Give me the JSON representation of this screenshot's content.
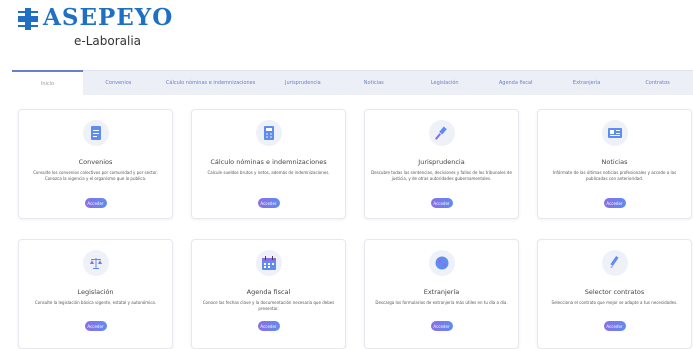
{
  "brand": {
    "name": "ASEPEYO",
    "subtitle": "e-Laboralia"
  },
  "tabs": [
    {
      "label": "Inicio"
    },
    {
      "label": "Convenios"
    },
    {
      "label": "Cálculo nóminas e indemnizaciones"
    },
    {
      "label": "Jurisprudencia"
    },
    {
      "label": "Noticias"
    },
    {
      "label": "Legislación"
    },
    {
      "label": "Agenda fiscal"
    },
    {
      "label": "Extranjería"
    },
    {
      "label": "Contratos"
    }
  ],
  "cards": [
    {
      "title": "Convenios",
      "desc": "Consulte los convenios colectivos por comunidad y por sector. Conozca la vigencia y el organismo que lo publica.",
      "button": "Acceder",
      "icon": "document-icon"
    },
    {
      "title": "Cálculo nóminas e indemnizaciones",
      "desc": "Calcule sueldos brutos y netos, además de indemnizaciones.",
      "button": "Acceder",
      "icon": "calculator-icon"
    },
    {
      "title": "Jurisprudencia",
      "desc": "Descubre todas las sentencias, decisiones y fallos de los tribunales de justicia, y de otras autoridades gubernamentales.",
      "button": "Acceder",
      "icon": "gavel-icon"
    },
    {
      "title": "Noticias",
      "desc": "Infórmate de las últimas noticias profesionales y accede a las publicadas con anterioridad.",
      "button": "Acceder",
      "icon": "newspaper-icon"
    },
    {
      "title": "Legislación",
      "desc": "Consulte la legislación básica vigente, estatal y autonómica.",
      "button": "Acceder",
      "icon": "scales-icon"
    },
    {
      "title": "Agenda fiscal",
      "desc": "Conoce las fechas clave y la documentación necesaria que debes presentar.",
      "button": "Acceder",
      "icon": "calendar-icon"
    },
    {
      "title": "Extranjería",
      "desc": "Descarga los formularios de extranjería más útiles en tu día a día.",
      "button": "Acceder",
      "icon": "globe-icon"
    },
    {
      "title": "Selector contratos",
      "desc": "Selecciona el contrato que mejor se adapte a tus necesidades.",
      "button": "Acceder",
      "icon": "pen-icon"
    }
  ],
  "colors": {
    "brand": "#1f6fc4",
    "tab_text": "#6b7fc9",
    "button_start": "#8a6ee6",
    "button_end": "#5f8cf0"
  }
}
